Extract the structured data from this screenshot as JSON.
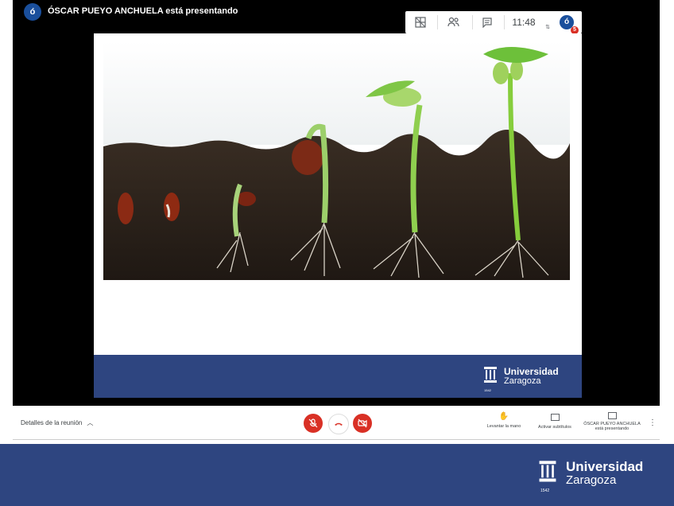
{
  "topbar": {
    "presenter_title": "ÓSCAR PUEYO ANCHUELA está presentando",
    "avatar_letter": "ó"
  },
  "controls": {
    "time": "11:48",
    "self_avatar_letter": "ó",
    "notification_count": "5"
  },
  "slide": {
    "logo_line1": "Universidad",
    "logo_line2": "Zaragoza",
    "logo_year": "1542"
  },
  "bottombar": {
    "details_label": "Detalles de la reunión",
    "raise_hand_label": "Levantar la mano",
    "captions_label": "Activar subtítulos",
    "presenting_label_1": "ÓSCAR PUEYO ANCHUELA",
    "presenting_label_2": "está presentando"
  },
  "banner": {
    "logo_line1": "Universidad",
    "logo_line2": "Zaragoza",
    "logo_year": "1542"
  },
  "colors": {
    "brand_blue": "#2e4580",
    "mic_red": "#d93025",
    "avatar_blue": "#1a4f9c"
  },
  "icons": [
    "grid-icon",
    "people-icon",
    "chat-icon",
    "mic-off-icon",
    "hangup-icon",
    "camera-off-icon",
    "raise-hand-icon",
    "captions-icon",
    "present-icon",
    "more-vert-icon",
    "chevron-up-icon"
  ]
}
